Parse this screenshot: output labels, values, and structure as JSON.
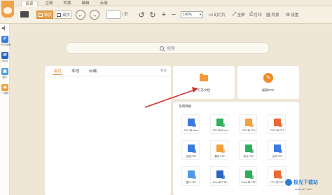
{
  "menu": {
    "tabs": [
      "阅读",
      "注释",
      "转换",
      "编辑",
      "云端"
    ]
  },
  "toolbar": {
    "single_page": "单页",
    "double_page": "双页",
    "page_total": "/ 页",
    "zoom": "100%",
    "slideshow": "幻灯片",
    "fullscreen": "全屏",
    "print": "打印",
    "background": "背景",
    "settings": "设置"
  },
  "left_strip": {
    "apps": [
      {
        "label": "PDF转换",
        "color": "#3b7be0",
        "glyph": "P"
      },
      {
        "label": "Word",
        "color": "#2b64c6",
        "glyph": "W"
      },
      {
        "label": "图片",
        "color": "#4b9be6",
        "glyph": "▣"
      },
      {
        "label": "一体机",
        "color": "#f2a03c",
        "glyph": "◆"
      }
    ]
  },
  "search": {
    "placeholder": "搜索"
  },
  "recent": {
    "tabs": [
      "最近",
      "本地",
      "云端"
    ],
    "active_tab": "最近",
    "more": "更多"
  },
  "cards": {
    "open_doc": "打开文档",
    "edit_pdf": "编辑PDF"
  },
  "convert": {
    "title": "常用转换",
    "items": [
      {
        "label": "PDF 转 Word",
        "color": "#3b7be0"
      },
      {
        "label": "PDF 转 Excel",
        "color": "#2fae5b"
      },
      {
        "label": "PDF 转 JPG",
        "color": "#f2a03c"
      },
      {
        "label": "PDF 转 PPT",
        "color": "#ea6a35"
      },
      {
        "label": "压缩 PDF",
        "color": "#3b7be0"
      },
      {
        "label": "翻译 PDF",
        "color": "#f2a03c"
      },
      {
        "label": "拆分 PDF",
        "color": "#2fae5b"
      },
      {
        "label": "合并 PDF",
        "color": "#3b7be0"
      },
      {
        "label": "图片 PDF",
        "color": "#4b9be6"
      },
      {
        "label": "Word 转 PDF",
        "color": "#2b64c6"
      },
      {
        "label": "Excel 转 PDF",
        "color": "#2fae5b"
      },
      {
        "label": "PPT 转 PDF",
        "color": "#ea6a35"
      }
    ]
  },
  "watermark": {
    "brand": "极光下载站",
    "url": "www.xz7.com"
  },
  "colors": {
    "accent": "#e58a2a",
    "annotation_arrow": "#d0342c"
  }
}
